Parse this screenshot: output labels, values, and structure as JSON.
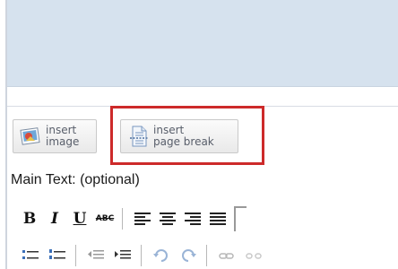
{
  "editor": {
    "buttons": {
      "insert_image": {
        "line1": "insert",
        "line2": "image",
        "icon": "image-icon"
      },
      "insert_page_break": {
        "line1": "insert",
        "line2": "page break",
        "icon": "page-break-icon"
      }
    },
    "highlight_color": "#cd2a2a",
    "field_label": "Main Text: (optional)",
    "toolbar": {
      "bold": "B",
      "italic": "I",
      "underline": "U",
      "strikethrough": "ABC"
    }
  }
}
